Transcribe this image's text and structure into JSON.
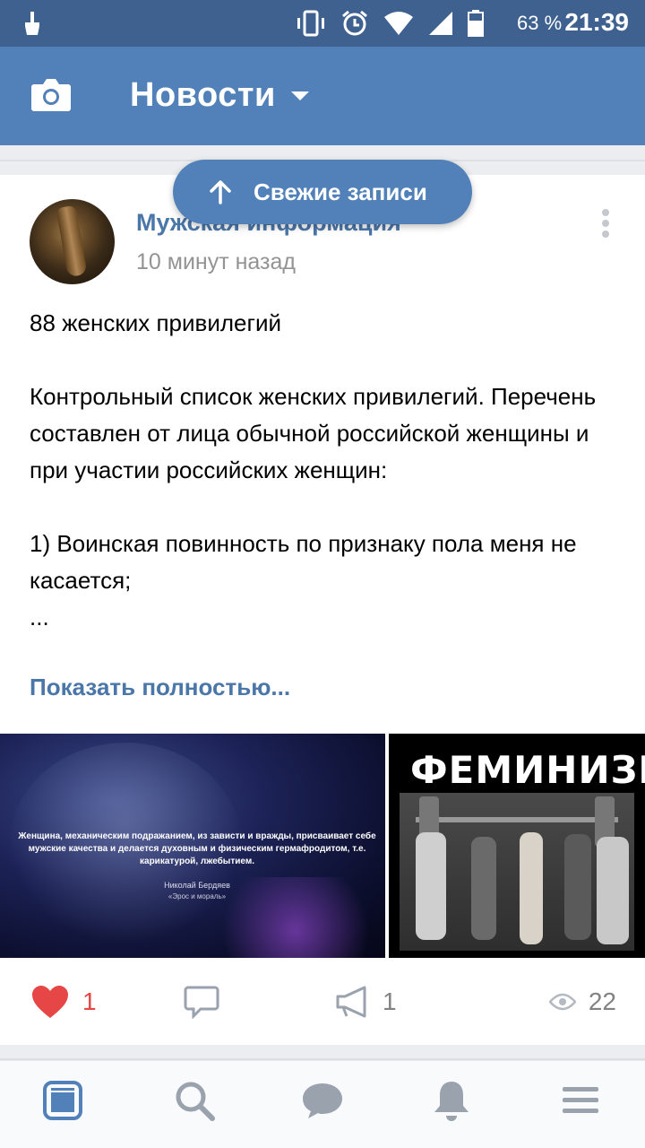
{
  "status_bar": {
    "battery_percent": "63 %",
    "time": "21:39",
    "icons": [
      "broom-icon",
      "vibrate-icon",
      "alarm-icon",
      "wifi-icon",
      "signal-icon",
      "battery-icon"
    ]
  },
  "header": {
    "title": "Новости",
    "camera_icon": "camera-icon",
    "dropdown_icon": "caret-down-icon"
  },
  "fresh_posts": {
    "label": "Свежие записи",
    "icon": "arrow-up-icon"
  },
  "post": {
    "author": "Мужская информация",
    "time": "10 минут назад",
    "paragraphs": [
      "88 женских привилегий",
      "",
      "Контрольный список женских привилегий. Перечень составлен от лица обычной российской женщины и при участии российских женщин:",
      "",
      "1) Воинская повинность по признаку пола меня не касается;",
      "..."
    ],
    "show_more": "Показать полностью...",
    "image1": {
      "quote": "Женщина, механическим подражанием, из зависти и вражды, присваивает себе мужские качества и делается духовным и физическим гермафродитом, т.е. карикатурой, лжебытием.",
      "author": "Николай Бердяев",
      "source": "«Эрос и мораль»"
    },
    "image2": {
      "title": "ФЕМИНИЗМ"
    },
    "likes": "1",
    "comments": "",
    "shares": "1",
    "views": "22"
  },
  "colors": {
    "status_bar": "#3f6190",
    "header": "#5181b8",
    "link": "#4a76a8",
    "like": "#e64646",
    "muted": "#828282"
  },
  "bottom_nav": [
    "news-icon",
    "search-icon",
    "messages-icon",
    "notifications-icon",
    "menu-icon"
  ]
}
